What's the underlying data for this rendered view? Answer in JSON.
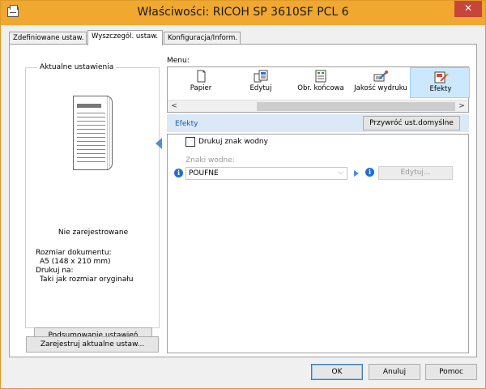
{
  "window": {
    "title": "Właściwości: RICOH SP 3610SF PCL 6",
    "close_label": "✕",
    "accent_color": "#f0a830"
  },
  "tabs": [
    {
      "label": "Zdefiniowane ustaw."
    },
    {
      "label": "Wyszczegól. ustaw.",
      "active": true
    },
    {
      "label": "Konfiguracja/Inform."
    }
  ],
  "left_panel": {
    "group_label": "Aktualne ustawienia",
    "status": "Nie zarejestrowane",
    "doc_size_label": "Rozmiar dokumentu:",
    "doc_size_value": "A5 (148 x 210 mm)",
    "print_on_label": "Drukuj na:",
    "print_on_value": "Taki jak rozmiar oryginału",
    "summary_button": "Podsumowanie ustawień",
    "register_button": "Zarejestruj aktualne ustaw..."
  },
  "menu": {
    "label": "Menu:",
    "items": [
      {
        "label": "Papier",
        "icon": "paper-icon"
      },
      {
        "label": "Edytuj",
        "icon": "edit-layout-icon"
      },
      {
        "label": "Obr. końcowa",
        "icon": "finishing-icon"
      },
      {
        "label": "Jakość wydruku",
        "icon": "print-quality-icon"
      },
      {
        "label": "Efekty",
        "icon": "effects-icon",
        "selected": true
      }
    ],
    "scroll_left": "<",
    "scroll_right": ">"
  },
  "effects": {
    "title": "Efekty",
    "restore_button": "Przywróć ust.domyślne",
    "watermark_checkbox_label": "Drukuj znak wodny",
    "watermark_checked": false,
    "watermarks_label": "Znaki wodne:",
    "watermark_selected": "POUFNE",
    "edit_button": "Edytuj..."
  },
  "footer": {
    "ok": "OK",
    "cancel": "Anuluj",
    "help": "Pomoc"
  }
}
